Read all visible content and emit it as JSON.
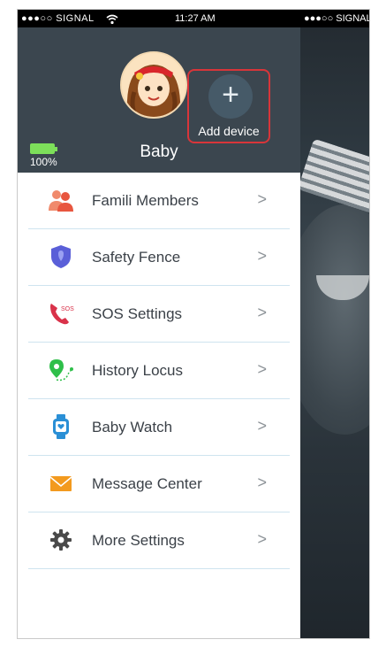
{
  "status_bar": {
    "left": "●●●○○ SIGNAL",
    "wifi_icon": "wifi-icon",
    "time": "11:27 AM",
    "right": "●●●○○ SIGNAL"
  },
  "header": {
    "device_name": "Baby",
    "battery_percent": "100%",
    "battery_level": 1.0,
    "add_device_label": "Add device"
  },
  "menu": {
    "items": [
      {
        "label": "Famili Members",
        "icon": "family-members-icon"
      },
      {
        "label": "Safety Fence",
        "icon": "shield-icon"
      },
      {
        "label": "SOS Settings",
        "icon": "sos-phone-icon"
      },
      {
        "label": "History Locus",
        "icon": "location-pin-icon"
      },
      {
        "label": "Baby Watch",
        "icon": "watch-icon"
      },
      {
        "label": "Message Center",
        "icon": "envelope-icon"
      },
      {
        "label": "More Settings",
        "icon": "gear-icon"
      }
    ],
    "chevron": ">"
  },
  "colors": {
    "header_bg": "#3b464f",
    "highlight_border": "#d8353a",
    "divider": "#cfe4ef"
  }
}
